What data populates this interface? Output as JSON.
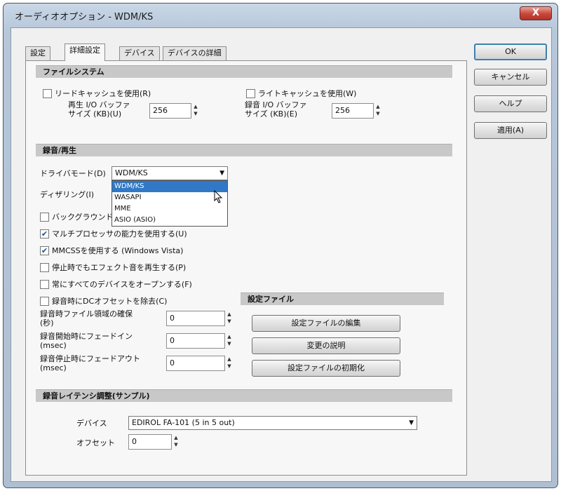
{
  "window": {
    "title": "オーディオオプション - WDM/KS",
    "close_label": "X"
  },
  "tabs": [
    {
      "label": "設定"
    },
    {
      "label": "詳細設定"
    },
    {
      "label": "デバイス"
    },
    {
      "label": "デバイスの詳細"
    }
  ],
  "side_buttons": {
    "ok": "OK",
    "cancel": "キャンセル",
    "help": "ヘルプ",
    "apply": "適用(A)"
  },
  "filesystem": {
    "header": "ファイルシステム",
    "read_cache": {
      "label": "リードキャッシュを使用(R)",
      "checked": false
    },
    "playback_buffer_label": "再生 I/O バッファ\nサイズ (KB)(U)",
    "playback_buffer_value": "256",
    "write_cache": {
      "label": "ライトキャッシュを使用(W)",
      "checked": false
    },
    "record_buffer_label": "録音 I/O バッファ\nサイズ (KB)(E)",
    "record_buffer_value": "256"
  },
  "recording": {
    "header": "録音/再生",
    "driver_mode_label": "ドライバモード(D)",
    "driver_mode_value": "WDM/KS",
    "driver_mode_options": [
      "WDM/KS",
      "WASAPI",
      "MME",
      "ASIO (ASIO)"
    ],
    "dithering_label": "ディザリング(I)",
    "background_label": "バックグラウンド",
    "multi_processor": {
      "label": "マルチプロセッサの能力を使用する(U)",
      "checked": true
    },
    "mmcss": {
      "label": "MMCSSを使用する (Windows Vista)",
      "checked": true
    },
    "play_on_stop": {
      "label": "停止時でもエフェクト音を再生する(P)",
      "checked": false
    },
    "open_devices": {
      "label": "常にすべてのデバイスをオープンする(F)",
      "checked": false
    },
    "record_offset": {
      "label": "録音時にDCオフセットを除去(C)",
      "checked": false
    },
    "fields": [
      {
        "label": "録音時ファイル領域の確保\n(秒)",
        "value": "0"
      },
      {
        "label": "録音開始時にフェードイン\n(msec)",
        "value": "0"
      },
      {
        "label": "録音停止時にフェードアウト\n(msec)",
        "value": "0"
      }
    ]
  },
  "config_file": {
    "header": "設定ファイル",
    "edit_button": "設定ファイルの編集",
    "change_button": "変更の説明",
    "reset_button": "設定ファイルの初期化"
  },
  "latency": {
    "header": "録音レイテンシ調整(サンプル)",
    "device_label": "デバイス",
    "device_value": "EDIROL FA-101 (5 in 5 out)",
    "offset_label": "オフセット",
    "offset_value": "0"
  },
  "colors": {
    "section_bg": "#c8c8c8",
    "selection": "#3179c7",
    "window_frame": "#b6c7da"
  }
}
